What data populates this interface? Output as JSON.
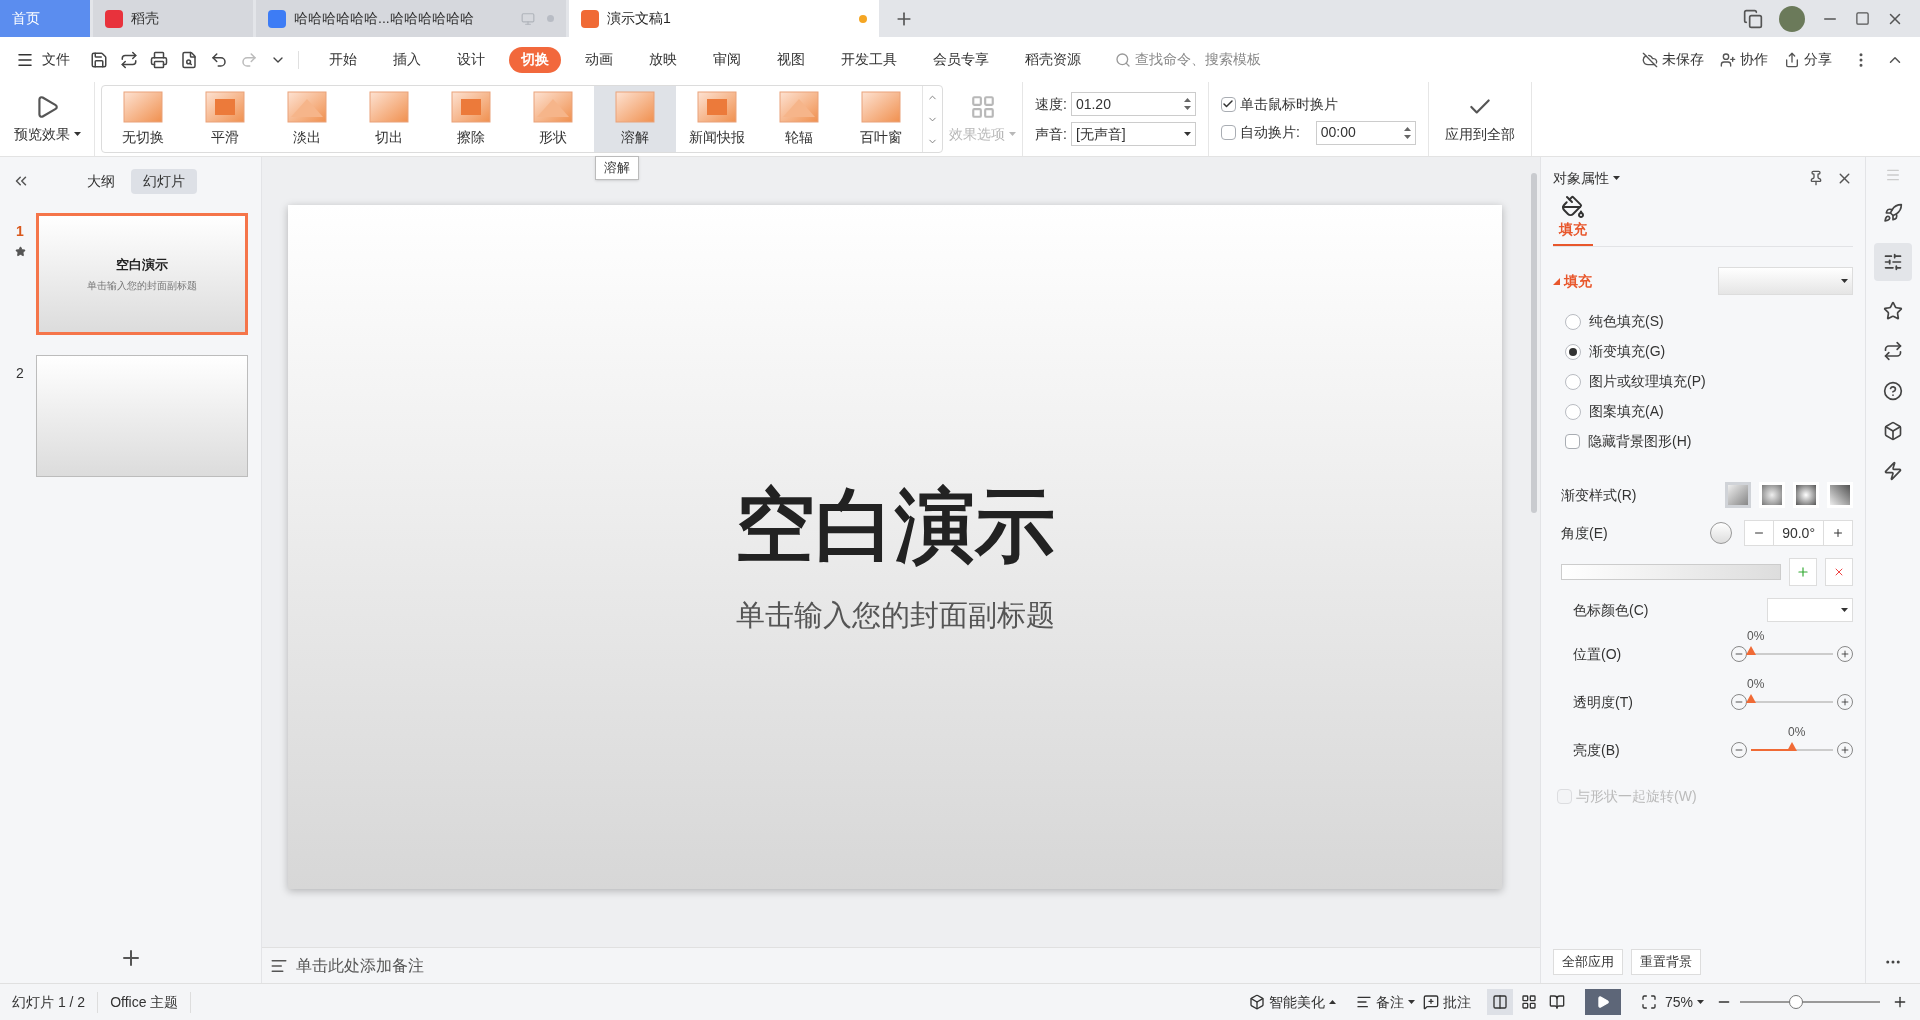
{
  "tabs": [
    {
      "label": "首页",
      "kind": "home",
      "selected": false
    },
    {
      "label": "稻壳",
      "kind": "docer",
      "selected": false
    },
    {
      "label": "哈哈哈哈哈哈...哈哈哈哈哈哈",
      "kind": "writer",
      "selected": false
    },
    {
      "label": "演示文稿1",
      "kind": "presentation",
      "selected": true
    }
  ],
  "menu": {
    "file": "文件",
    "items": [
      {
        "label": "开始",
        "selected": false
      },
      {
        "label": "插入",
        "selected": false
      },
      {
        "label": "设计",
        "selected": false
      },
      {
        "label": "切换",
        "selected": true
      },
      {
        "label": "动画",
        "selected": false
      },
      {
        "label": "放映",
        "selected": false
      },
      {
        "label": "审阅",
        "selected": false
      },
      {
        "label": "视图",
        "selected": false
      },
      {
        "label": "开发工具",
        "selected": false
      },
      {
        "label": "会员专享",
        "selected": false
      },
      {
        "label": "稻壳资源",
        "selected": false
      }
    ],
    "search": {
      "placeholder": "查找命令、搜索模板"
    },
    "actions": [
      "未保存",
      "协作",
      "分享"
    ]
  },
  "ribbon": {
    "preview": "预览效果",
    "transitions": [
      {
        "label": "无切换",
        "selected": false
      },
      {
        "label": "平滑",
        "selected": false
      },
      {
        "label": "淡出",
        "selected": false
      },
      {
        "label": "切出",
        "selected": false
      },
      {
        "label": "擦除",
        "selected": false
      },
      {
        "label": "形状",
        "selected": false
      },
      {
        "label": "溶解",
        "selected": true
      },
      {
        "label": "新闻快报",
        "selected": false
      },
      {
        "label": "轮辐",
        "selected": false
      },
      {
        "label": "百叶窗",
        "selected": false
      }
    ],
    "tooltip": "溶解",
    "effect_options": "效果选项",
    "speed_label": "速度:",
    "speed": "01.20",
    "sound_label": "声音:",
    "sound": "[无声音]",
    "on_click": {
      "label": "单击鼠标时换片",
      "checked": true
    },
    "auto": {
      "label": "自动换片:",
      "checked": false,
      "value": "00:00"
    },
    "apply_all": "应用到全部"
  },
  "left_panel": {
    "tabs": [
      {
        "label": "大纲",
        "selected": false
      },
      {
        "label": "幻灯片",
        "selected": true
      }
    ],
    "slides": [
      {
        "number": "1",
        "selected": true,
        "title": "空白演示",
        "subtitle": "单击输入您的封面副标题"
      },
      {
        "number": "2",
        "selected": false
      }
    ]
  },
  "slide": {
    "title": "空白演示",
    "subtitle": "单击输入您的封面副标题"
  },
  "notes": {
    "placeholder": "单击此处添加备注"
  },
  "panel": {
    "title": "对象属性",
    "tab": "填充",
    "section": "填充",
    "fill_options": [
      {
        "label": "纯色填充(S)",
        "selected": false
      },
      {
        "label": "渐变填充(G)",
        "selected": true
      },
      {
        "label": "图片或纹理填充(P)",
        "selected": false
      },
      {
        "label": "图案填充(A)",
        "selected": false
      }
    ],
    "hide_bg": {
      "label": "隐藏背景图形(H)",
      "checked": false
    },
    "gradient_style": "渐变样式(R)",
    "gradient_styles": [
      {
        "kind": "linear",
        "selected": true
      },
      {
        "kind": "radial",
        "selected": false
      },
      {
        "kind": "rectangular",
        "selected": false
      },
      {
        "kind": "path",
        "selected": false
      }
    ],
    "angle_label": "角度(E)",
    "angle": "90.0°",
    "stop_color": "色标颜色(C)",
    "sliders": [
      {
        "label": "位置(O)",
        "reading": "0%",
        "level": 0
      },
      {
        "label": "透明度(T)",
        "reading": "0%",
        "level": 0
      },
      {
        "label": "亮度(B)",
        "reading": "0%",
        "level": 0.5
      }
    ],
    "rotate": {
      "label": "与形状一起旋转(W)",
      "checked": false,
      "disabled": true
    },
    "buttons": [
      "全部应用",
      "重置背景"
    ]
  },
  "status": {
    "slide": "幻灯片 1 / 2",
    "theme": "Office 主题",
    "beautify": "智能美化",
    "notes": "备注",
    "comments": "批注",
    "zoom": "75%",
    "zoom_slider": {
      "level": 0.4
    }
  }
}
